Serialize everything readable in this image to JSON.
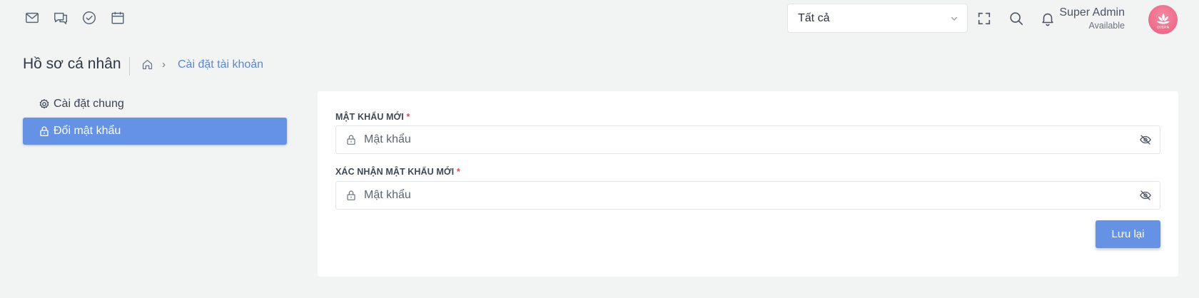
{
  "header": {
    "app_icons": [
      {
        "name": "mail-icon"
      },
      {
        "name": "chat-icon"
      },
      {
        "name": "check-circle-icon"
      },
      {
        "name": "calendar-icon"
      }
    ],
    "filter": {
      "selected": "Tất cả"
    },
    "tools": [
      {
        "name": "fullscreen-icon"
      },
      {
        "name": "search-icon"
      },
      {
        "name": "bell-icon"
      }
    ],
    "user": {
      "name": "Super Admin",
      "status": "Available",
      "avatar_text": "DISPA",
      "avatar_color": "#ec6b8a"
    }
  },
  "breadcrumb": {
    "title": "Hồ sơ cá nhân",
    "separator": "›",
    "current": "Cài đặt tài khoản"
  },
  "sidebar": {
    "items": [
      {
        "label": "Cài đặt chung",
        "icon": "gear-icon",
        "active": false
      },
      {
        "label": "Đổi mật khẩu",
        "icon": "lock-icon",
        "active": true
      }
    ]
  },
  "form": {
    "fields": [
      {
        "label": "MẬT KHẨU MỚI",
        "required_mark": "*",
        "placeholder": "Mật khẩu",
        "value": ""
      },
      {
        "label": "XÁC NHẬN MẬT KHẨU MỚI",
        "required_mark": "*",
        "placeholder": "Mật khẩu",
        "value": ""
      }
    ],
    "save_label": "Lưu lại"
  },
  "colors": {
    "accent": "#6592e4",
    "link": "#5c87d6",
    "required": "#e5484d",
    "background": "#f2f3f3"
  }
}
